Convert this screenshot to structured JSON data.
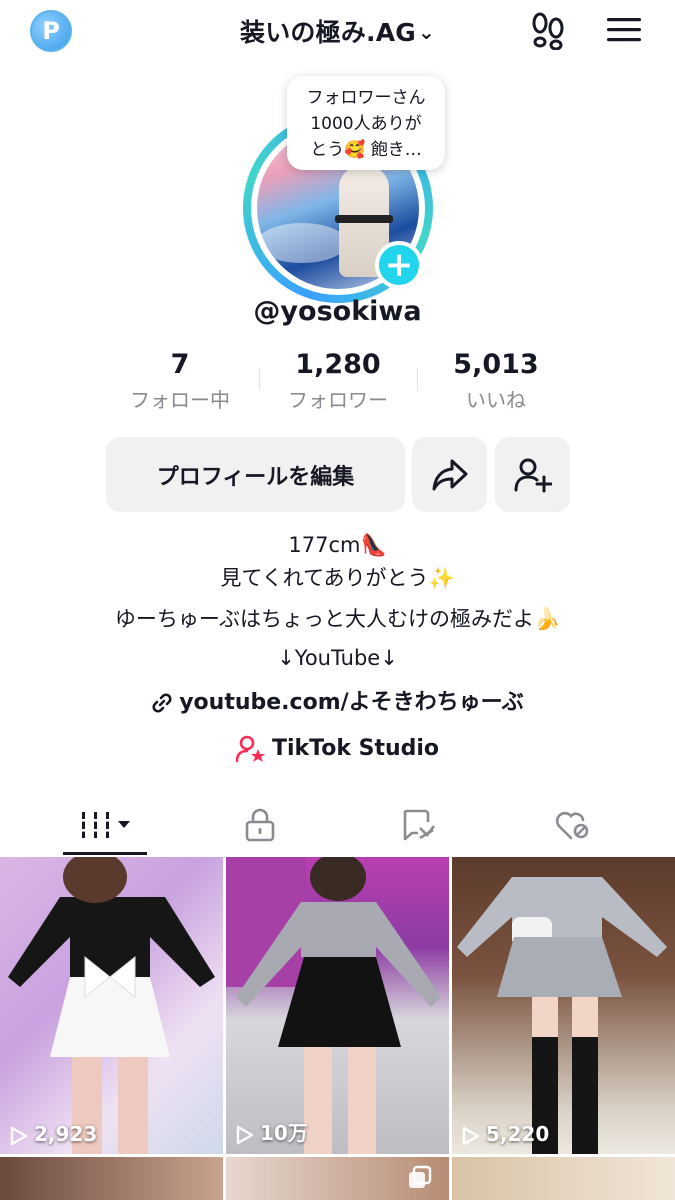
{
  "header": {
    "account_name": "装いの極み.AG",
    "dropdown_icon": "chevron-down-icon",
    "left_icon": "app-logo-icon",
    "footprint_icon": "footprint-icon",
    "menu_icon": "hamburger-menu-icon"
  },
  "profile": {
    "note_bubble": [
      "フォロワーさん",
      "1000人ありが",
      "とう🥰 飽き…"
    ],
    "username": "@yosokiwa",
    "stats": [
      {
        "value": "7",
        "label": "フォロー中"
      },
      {
        "value": "1,280",
        "label": "フォロワー"
      },
      {
        "value": "5,013",
        "label": "いいね"
      }
    ],
    "buttons": {
      "edit_profile": "プロフィールを編集",
      "share_icon": "share-icon",
      "add_friend_icon": "add-friend-icon"
    },
    "bio": [
      "177cm👠",
      "見てくれてありがとう✨",
      "ゆーちゅーぶはちょっと大人むけの極みだよ🍌",
      "↓YouTube↓"
    ],
    "link": "youtube.com/よそきわちゅーぶ",
    "studio": "TikTok Studio"
  },
  "tabs": [
    {
      "name": "videos",
      "icon": "grid-icon"
    },
    {
      "name": "private",
      "icon": "lock-icon"
    },
    {
      "name": "reposts",
      "icon": "repost-icon"
    },
    {
      "name": "liked",
      "icon": "liked-heart-icon"
    }
  ],
  "videos": [
    {
      "views": "2,923"
    },
    {
      "views": "10万"
    },
    {
      "views": "5,220"
    }
  ],
  "colors": {
    "accent": "#20d5ec",
    "ring_blue": "#3aa0ff",
    "ring_teal": "#41d6c9",
    "studio_icon": "#fe2c55",
    "text": "#161823",
    "secondary": "#8a8b91"
  }
}
